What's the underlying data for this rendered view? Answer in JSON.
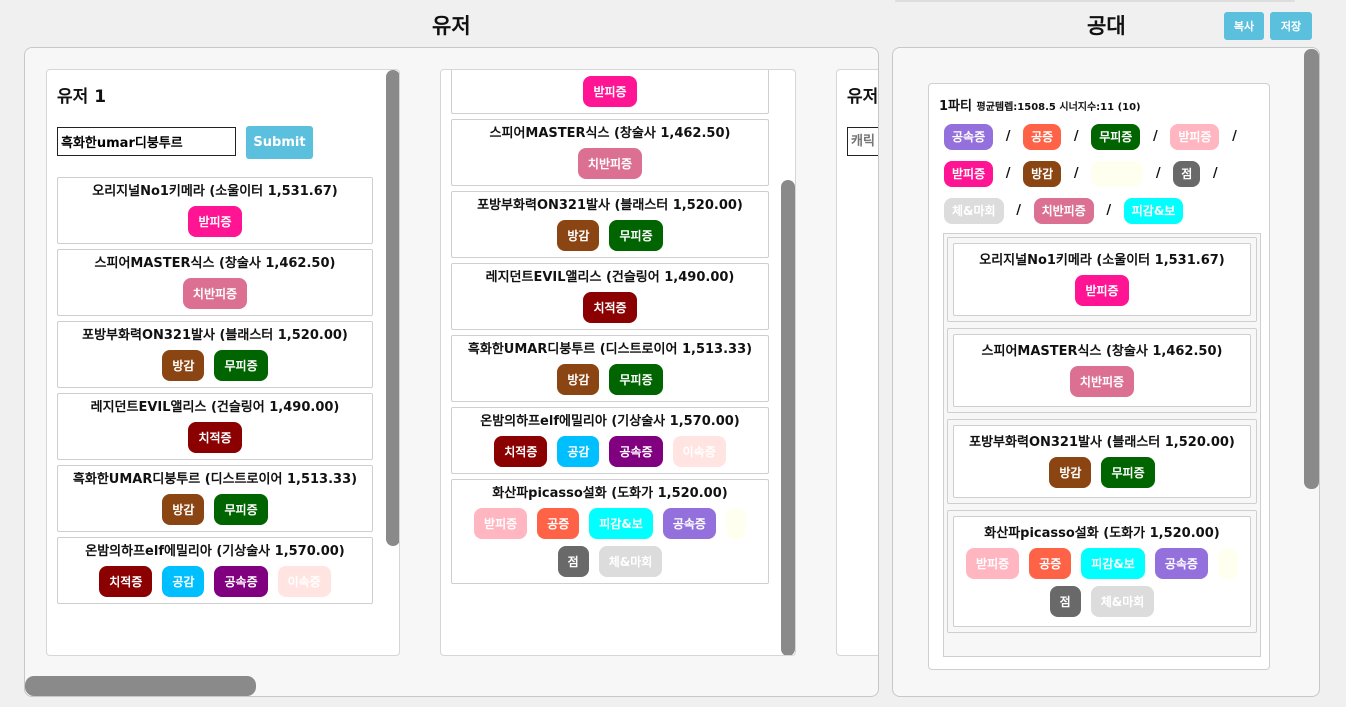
{
  "header": {
    "user_title": "유저",
    "raid_title": "공대",
    "copy_label": "복사",
    "save_label": "저장"
  },
  "users": [
    {
      "name": "유저 1",
      "input_value": "흑화한umar디붕투르",
      "submit_label": "Submit",
      "characters": [
        {
          "title": "오리지널No1키메라 (소울이터 1,531.67)",
          "tags": [
            {
              "label": "받피증",
              "color": "#ff1493"
            }
          ]
        },
        {
          "title": "스피어MASTER식스 (창술사 1,462.50)",
          "tags": [
            {
              "label": "치반피증",
              "color": "#db7093"
            }
          ]
        },
        {
          "title": "포방부화력ON321발사 (블래스터 1,520.00)",
          "tags": [
            {
              "label": "방감",
              "color": "#8b4513"
            },
            {
              "label": "무피증",
              "color": "#006400"
            }
          ]
        },
        {
          "title": "레지던트EVIL앨리스 (건슬링어 1,490.00)",
          "tags": [
            {
              "label": "치적증",
              "color": "#8b0000"
            }
          ]
        },
        {
          "title": "흑화한UMAR디붕투르 (디스트로이어 1,513.33)",
          "tags": [
            {
              "label": "방감",
              "color": "#8b4513"
            },
            {
              "label": "무피증",
              "color": "#006400"
            }
          ]
        },
        {
          "title": "온밤의하프elf에밀리아 (기상술사 1,570.00)",
          "tags": [
            {
              "label": "치적증",
              "color": "#8b0000"
            },
            {
              "label": "공감",
              "color": "#00bfff"
            },
            {
              "label": "공속증",
              "color": "#800080"
            },
            {
              "label": "이속증",
              "color": "#ffe4e1"
            }
          ]
        }
      ]
    },
    {
      "characters": [
        {
          "title": "",
          "tags": [
            {
              "label": "받피증",
              "color": "#ff1493"
            }
          ]
        },
        {
          "title": "스피어MASTER식스 (창술사 1,462.50)",
          "tags": [
            {
              "label": "치반피증",
              "color": "#db7093"
            }
          ]
        },
        {
          "title": "포방부화력ON321발사 (블래스터 1,520.00)",
          "tags": [
            {
              "label": "방감",
              "color": "#8b4513"
            },
            {
              "label": "무피증",
              "color": "#006400"
            }
          ]
        },
        {
          "title": "레지던트EVIL앨리스 (건슬링어 1,490.00)",
          "tags": [
            {
              "label": "치적증",
              "color": "#8b0000"
            }
          ]
        },
        {
          "title": "흑화한UMAR디붕투르 (디스트로이어 1,513.33)",
          "tags": [
            {
              "label": "방감",
              "color": "#8b4513"
            },
            {
              "label": "무피증",
              "color": "#006400"
            }
          ]
        },
        {
          "title": "온밤의하프elf에밀리아 (기상술사 1,570.00)",
          "tags": [
            {
              "label": "치적증",
              "color": "#8b0000"
            },
            {
              "label": "공감",
              "color": "#00bfff"
            },
            {
              "label": "공속증",
              "color": "#800080"
            },
            {
              "label": "이속증",
              "color": "#ffe4e1"
            }
          ]
        },
        {
          "title": "화산파picasso설화 (도화가 1,520.00)",
          "tags": [
            {
              "label": "받피증",
              "color": "#ffb6c1"
            },
            {
              "label": "공증",
              "color": "#ff6347"
            },
            {
              "label": "피감&보",
              "color": "#00ffff"
            },
            {
              "label": "공속증",
              "color": "#9370db"
            },
            {
              "label": "",
              "color": "#fffff0"
            },
            {
              "label": "점",
              "color": "#696969"
            },
            {
              "label": "체&마회",
              "color": "#dcdcdc"
            }
          ]
        }
      ]
    },
    {
      "name": "유저",
      "input_placeholder": "캐릭"
    }
  ],
  "party": {
    "name": "1파티",
    "stats": "평균템렙:1508.5 시너지수:11 (10)",
    "synergy_rows": [
      [
        {
          "label": "공속증",
          "color": "#9370db"
        },
        {
          "label": "공증",
          "color": "#ff6347"
        },
        {
          "label": "무피증",
          "color": "#006400"
        },
        {
          "label": "받피증",
          "color": "#ffb6c1"
        }
      ],
      [
        {
          "label": "받피증",
          "color": "#ff1493"
        },
        {
          "label": "방감",
          "color": "#8b4513"
        },
        {
          "label": "",
          "color": "#fffff0"
        },
        {
          "label": "점",
          "color": "#696969"
        }
      ],
      [
        {
          "label": "체&마회",
          "color": "#dcdcdc"
        },
        {
          "label": "치반피증",
          "color": "#db7093"
        },
        {
          "label": "피감&보",
          "color": "#00ffff"
        }
      ]
    ],
    "separator": "/",
    "characters": [
      {
        "title": "오리지널No1키메라 (소울이터 1,531.67)",
        "tags": [
          {
            "label": "받피증",
            "color": "#ff1493"
          }
        ]
      },
      {
        "title": "스피어MASTER식스 (창술사 1,462.50)",
        "tags": [
          {
            "label": "치반피증",
            "color": "#db7093"
          }
        ]
      },
      {
        "title": "포방부화력ON321발사 (블래스터 1,520.00)",
        "tags": [
          {
            "label": "방감",
            "color": "#8b4513"
          },
          {
            "label": "무피증",
            "color": "#006400"
          }
        ]
      },
      {
        "title": "화산파picasso설화 (도화가 1,520.00)",
        "tags": [
          {
            "label": "받피증",
            "color": "#ffb6c1"
          },
          {
            "label": "공증",
            "color": "#ff6347"
          },
          {
            "label": "피감&보",
            "color": "#00ffff"
          },
          {
            "label": "공속증",
            "color": "#9370db"
          },
          {
            "label": "",
            "color": "#fffff0"
          },
          {
            "label": "점",
            "color": "#696969"
          },
          {
            "label": "체&마회",
            "color": "#dcdcdc"
          }
        ]
      }
    ]
  }
}
